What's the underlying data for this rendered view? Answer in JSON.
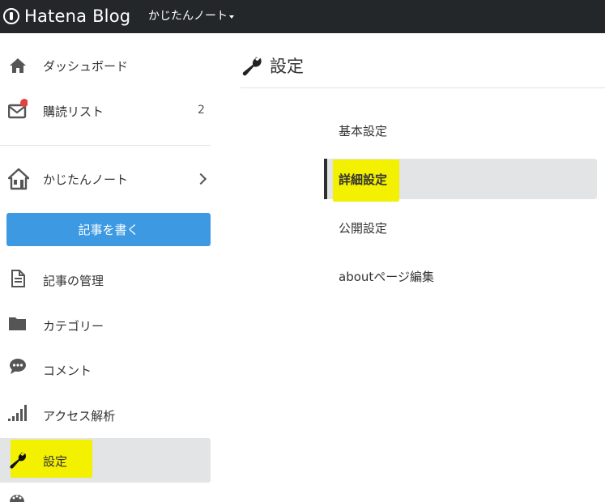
{
  "header": {
    "logo_text": "Hatena Blog",
    "blog_name": "かじたんノート"
  },
  "sidebar": {
    "items": [
      {
        "label": "ダッシュボード"
      },
      {
        "label": "購読リスト",
        "count": "2"
      },
      {
        "label": "かじたんノート"
      },
      {
        "label": "記事の管理"
      },
      {
        "label": "カテゴリー"
      },
      {
        "label": "コメント"
      },
      {
        "label": "アクセス解析"
      },
      {
        "label": "設定"
      }
    ],
    "write_button": "記事を書く"
  },
  "main": {
    "title": "設定",
    "menu": [
      {
        "label": "基本設定"
      },
      {
        "label": "詳細設定"
      },
      {
        "label": "公開設定"
      },
      {
        "label": "aboutページ編集"
      }
    ]
  },
  "colors": {
    "topbar": "#24272a",
    "accent_button": "#3d9ae2",
    "active_bg": "#e2e4e6",
    "highlight": "#f3f000",
    "notification_dot": "#e0433b"
  }
}
